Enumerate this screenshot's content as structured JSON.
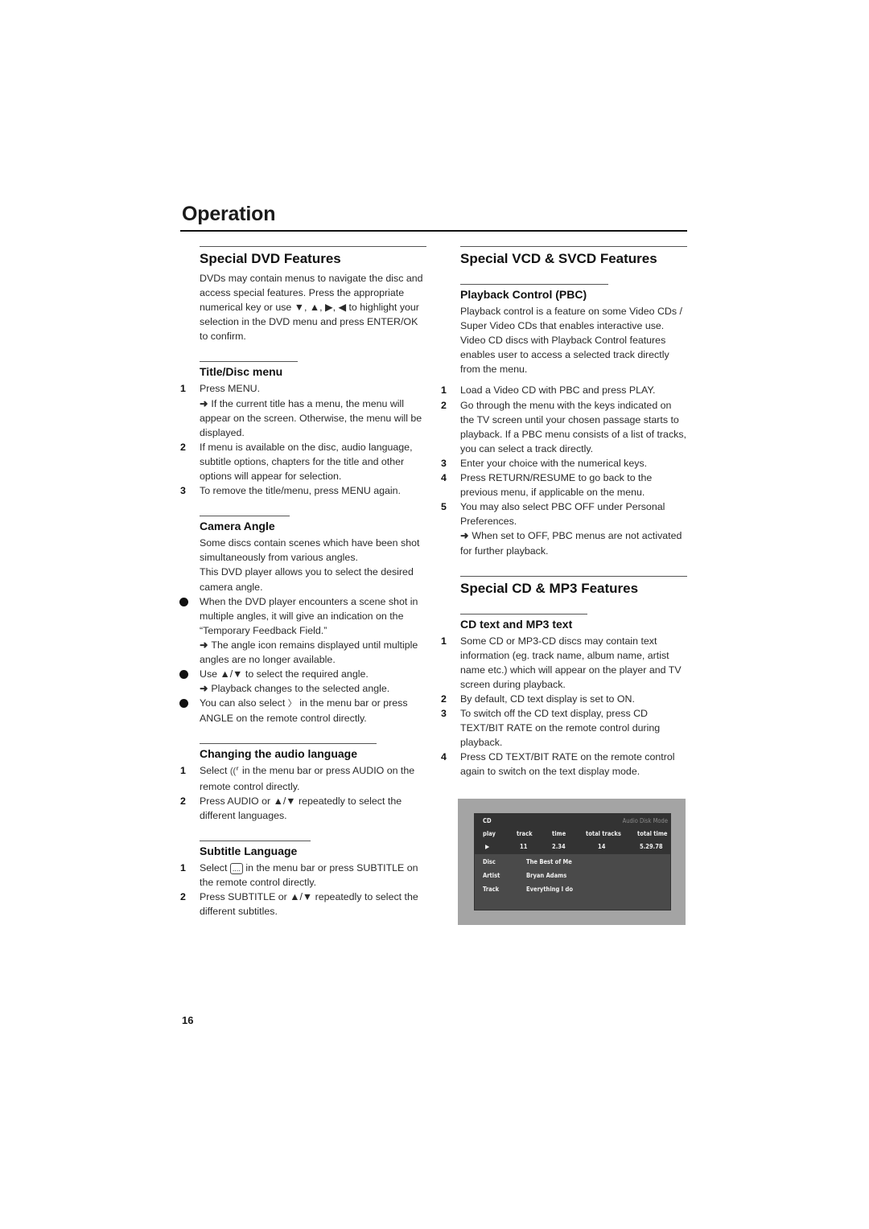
{
  "page": {
    "title": "Operation",
    "page_number": "16"
  },
  "dvd": {
    "title": "Special DVD Features",
    "intro": "DVDs may contain menus to navigate the disc and access special features. Press the appropriate numerical key or use ▼, ▲, ▶, ◀ to highlight your selection in the DVD menu and press ENTER/OK to confirm.",
    "title_disc": {
      "heading": "Title/Disc menu",
      "steps": [
        {
          "num": "1",
          "text": "Press MENU.",
          "note": "If the current title has a menu, the menu will appear on the screen. Otherwise, the menu will be displayed."
        },
        {
          "num": "2",
          "text": "If menu is available on the disc, audio language, subtitle options, chapters for the title and other options will appear for selection."
        },
        {
          "num": "3",
          "text": "To remove the title/menu, press MENU again."
        }
      ]
    },
    "camera": {
      "heading": "Camera Angle",
      "intro1": "Some discs contain scenes which have been shot simultaneously from various angles.",
      "intro2": "This DVD player allows you to select the desired camera angle.",
      "bullets": [
        {
          "text": "When the DVD player encounters a scene shot in multiple angles, it will give an indication on the “Temporary Feedback Field.”",
          "note": "The angle icon remains displayed until multiple angles are no longer available."
        },
        {
          "text": "Use ▲/▼ to select the required angle.",
          "note": "Playback changes to the selected angle."
        },
        {
          "text_before": "You can also select",
          "icon": "angle-icon",
          "text_after": "in the menu bar or press ANGLE on the remote control directly."
        }
      ]
    },
    "audio": {
      "heading": "Changing the audio language",
      "steps": [
        {
          "num": "1",
          "text_before": "Select",
          "icon": "audio-icon",
          "text_after": "in the menu bar or press AUDIO on the remote control directly."
        },
        {
          "num": "2",
          "text": "Press AUDIO or ▲/▼ repeatedly to select the different languages."
        }
      ]
    },
    "subtitle": {
      "heading": "Subtitle Language",
      "steps": [
        {
          "num": "1",
          "text_before": "Select",
          "icon": "subtitle-icon",
          "text_after": "in the menu bar or press SUBTITLE on the remote control directly."
        },
        {
          "num": "2",
          "text": "Press SUBTITLE or ▲/▼ repeatedly to select the different subtitles."
        }
      ]
    }
  },
  "vcd": {
    "title": "Special VCD & SVCD Features",
    "pbc": {
      "heading": "Playback Control (PBC)",
      "intro": "Playback control is a feature on some Video CDs / Super Video CDs that enables interactive use. Video CD discs with Playback Control features enables user to access a selected track directly from the menu.",
      "steps": [
        {
          "num": "1",
          "text": "Load a Video CD with PBC and press PLAY."
        },
        {
          "num": "2",
          "text": "Go through the menu with the keys indicated on the TV screen until your chosen passage starts to playback. If a PBC menu consists of a list of tracks, you can select a track directly."
        },
        {
          "num": "3",
          "text": "Enter your choice with the numerical keys."
        },
        {
          "num": "4",
          "text": "Press RETURN/RESUME to go back to the previous menu, if applicable on the menu."
        },
        {
          "num": "5",
          "text": "You may also select PBC OFF under Personal Preferences.",
          "note": "When set to OFF, PBC menus are not activated for further playback."
        }
      ]
    }
  },
  "cd": {
    "title": "Special CD & MP3 Features",
    "cdtext": {
      "heading": "CD text and MP3 text",
      "steps": [
        {
          "num": "1",
          "text": "Some CD or MP3-CD discs may contain text information (eg. track name, album name, artist name etc.) which will appear on the player and TV screen during playback."
        },
        {
          "num": "2",
          "text": "By default, CD text display is set to ON."
        },
        {
          "num": "3",
          "text": "To switch off the CD text display, press CD TEXT/BIT RATE on the remote control during playback."
        },
        {
          "num": "4",
          "text": "Press CD TEXT/BIT RATE on the remote control again to switch on the text display mode."
        }
      ]
    }
  },
  "osd": {
    "source": "CD",
    "mode": "Audio Disk Mode",
    "headers": [
      "play",
      "track",
      "time",
      "total tracks",
      "total time"
    ],
    "values": [
      "▶",
      "11",
      "2.34",
      "14",
      "5.29.78"
    ],
    "info": [
      {
        "label": "Disc",
        "value": "The Best of Me"
      },
      {
        "label": "Artist",
        "value": "Bryan Adams"
      },
      {
        "label": "Track",
        "value": "Everything I do"
      }
    ]
  },
  "symbols": {
    "arrow": "➜",
    "angle_icon": "〉",
    "audio_icon": "((⸢",
    "subtitle_icon": "...."
  }
}
